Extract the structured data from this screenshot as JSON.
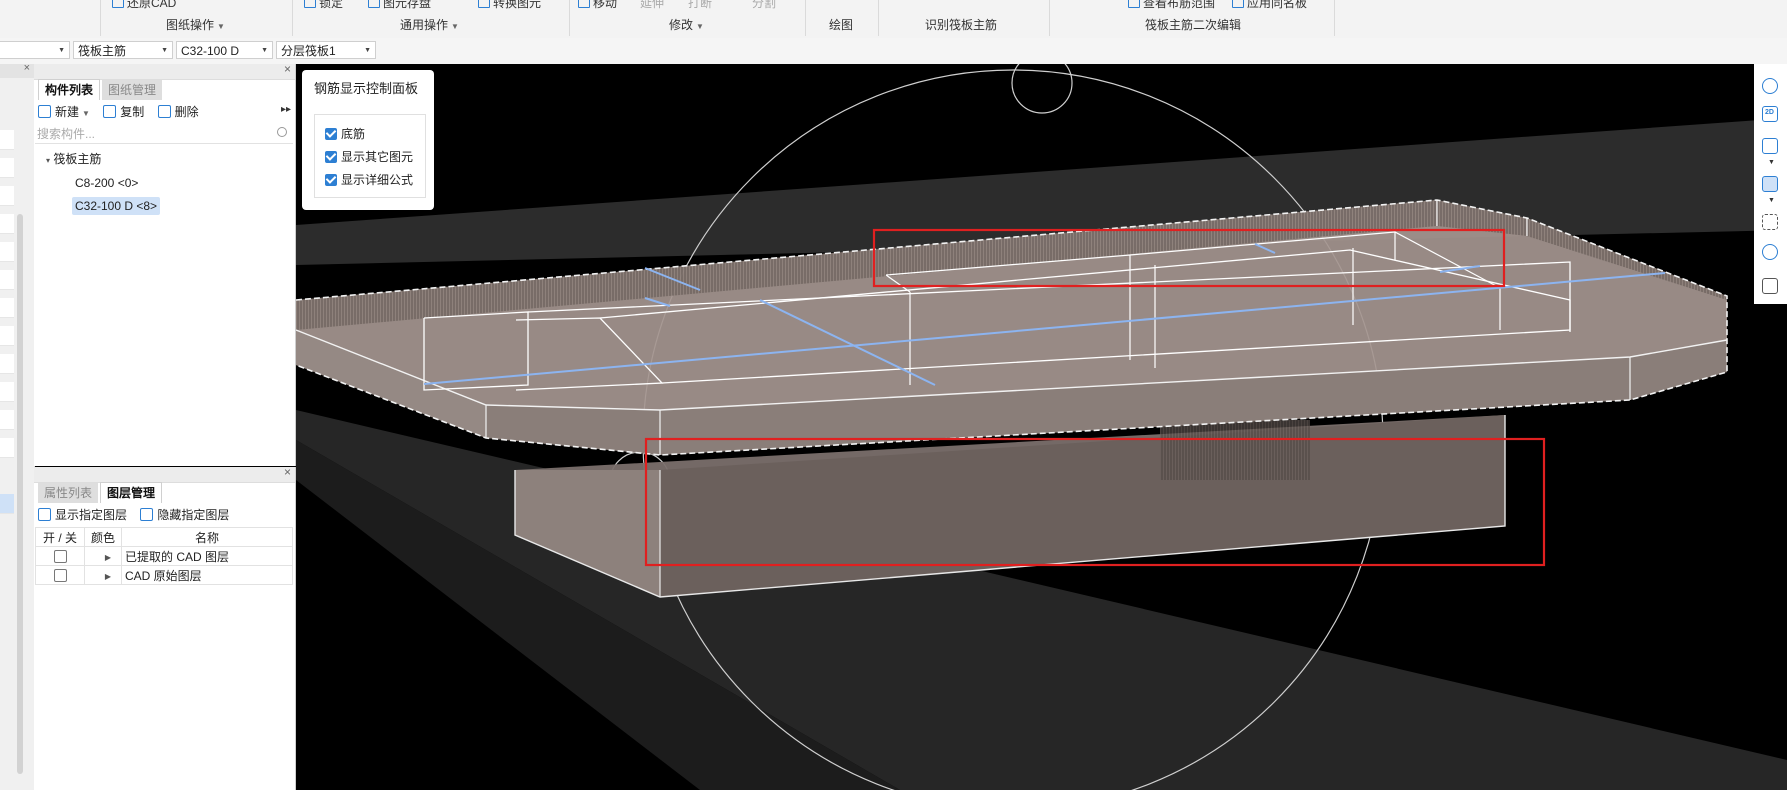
{
  "ribbon": {
    "top_items": [
      "还原CAD",
      "锁定",
      "图元存盘",
      "转换图元",
      "移动",
      "延伸",
      "打断",
      "分割",
      "查看布筋范围",
      "应用同名板"
    ],
    "groups": [
      "图纸操作",
      "通用操作",
      "修改",
      "绘图",
      "识别筏板主筋",
      "筏板主筋二次编辑"
    ]
  },
  "toolbar": {
    "selects": [
      "",
      "筏板主筋",
      "C32-100 D",
      "分层筏板1"
    ]
  },
  "component_panel": {
    "tabs": [
      "构件列表",
      "图纸管理"
    ],
    "buttons": [
      "新建",
      "复制",
      "删除"
    ],
    "search_placeholder": "搜索构件...",
    "tree": {
      "root": "筏板主筋",
      "items": [
        "C8-200 <0>",
        "C32-100 D <8>"
      ],
      "selected": "C32-100 D <8>"
    }
  },
  "layer_panel": {
    "tabs": [
      "属性列表",
      "图层管理"
    ],
    "buttons": [
      "显示指定图层",
      "隐藏指定图层"
    ],
    "columns": [
      "开 / 关",
      "颜色",
      "名称"
    ],
    "rows": [
      {
        "name": "已提取的 CAD 图层",
        "checked": false
      },
      {
        "name": "CAD 原始图层",
        "checked": false
      }
    ]
  },
  "rebar_panel": {
    "title": "钢筋显示控制面板",
    "options": [
      {
        "label": "底筋",
        "checked": true
      },
      {
        "label": "显示其它图元",
        "checked": true
      },
      {
        "label": "显示详细公式",
        "checked": true
      }
    ]
  },
  "right_tools": [
    "orbit-icon",
    "2d-view-icon",
    "3d-box-icon",
    "3d-solid-icon",
    "fullscreen-icon",
    "view-settings-icon",
    "list-settings-icon"
  ],
  "colors": {
    "accent": "#2d7fd3",
    "highlight_box": "#e02020",
    "selection": "#cfe1f7",
    "slab_fill": "#a59690",
    "rebar_blue": "#8cb4f0"
  }
}
